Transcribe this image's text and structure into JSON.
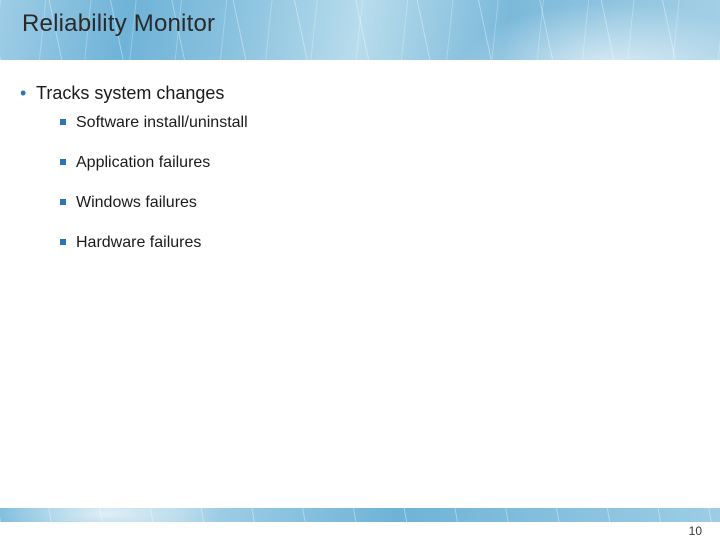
{
  "title": "Reliability Monitor",
  "page_number": "10",
  "body": {
    "level1": "Tracks system changes",
    "level2": [
      "Software install/uninstall",
      "Application failures",
      "Windows failures",
      "Hardware failures"
    ]
  }
}
